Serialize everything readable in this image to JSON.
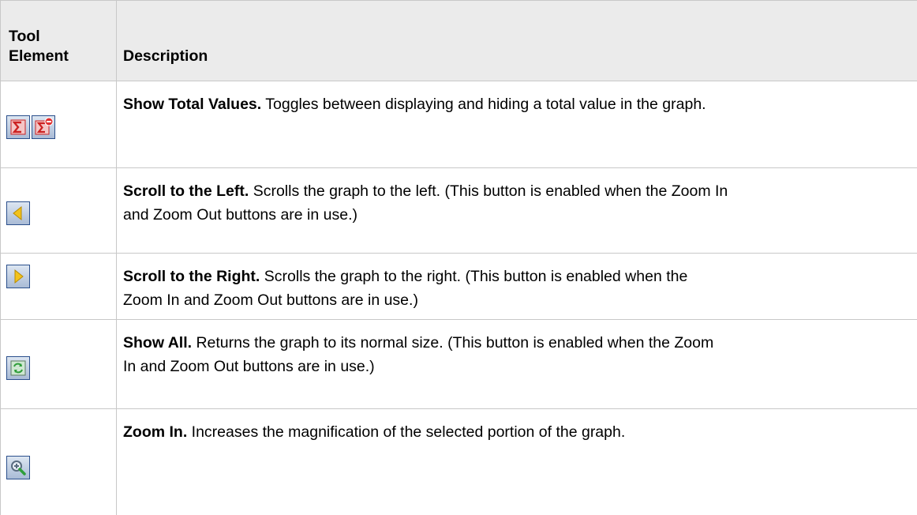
{
  "header": {
    "col1_line1": "Tool",
    "col1_line2": "Element",
    "col2": "Description"
  },
  "rows": [
    {
      "icons": [
        "show-total-values-icon",
        "hide-total-values-icon"
      ],
      "term": "Show Total Values.",
      "lines": [
        "Toggles between displaying and hiding a total value in the graph."
      ]
    },
    {
      "icons": [
        "scroll-left-icon"
      ],
      "term": "Scroll to the Left.",
      "lines": [
        "Scrolls the graph to the left. (This button is enabled when the Zoom In",
        "and Zoom Out buttons are in use.)"
      ]
    },
    {
      "icons": [
        "scroll-right-icon"
      ],
      "term": "Scroll to the Right.",
      "lines": [
        "Scrolls the graph to the right. (This button is enabled when the",
        "Zoom In and Zoom Out buttons are in use.)"
      ]
    },
    {
      "icons": [
        "show-all-icon"
      ],
      "term": "Show All.",
      "lines": [
        "Returns the graph to its normal size. (This button is enabled when the Zoom",
        "In and Zoom Out buttons are in use.)"
      ]
    },
    {
      "icons": [
        "zoom-in-icon"
      ],
      "term": "Zoom In.",
      "lines": [
        "Increases the magnification of the selected portion of the graph."
      ]
    }
  ],
  "colors": {
    "header_bg": "#ebebeb",
    "border": "#c8c8c8",
    "button_border": "#2b4f8c",
    "sigma_red": "#cc2222",
    "arrow_yellow": "#f2c21b",
    "refresh_green": "#2e9e3a"
  }
}
